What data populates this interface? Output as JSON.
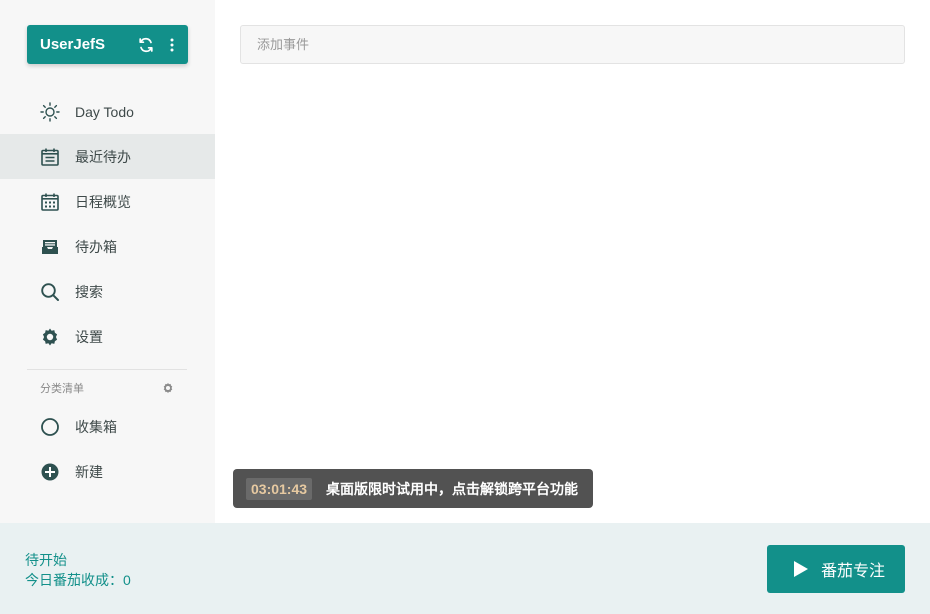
{
  "user": {
    "name": "UserJefS",
    "sync_icon": "refresh-icon",
    "menu_icon": "more-vertical-icon"
  },
  "nav": {
    "items": [
      {
        "label": "Day Todo",
        "icon": "sun-icon"
      },
      {
        "label": "最近待办",
        "icon": "calendar-list-icon",
        "active": true
      },
      {
        "label": "日程概览",
        "icon": "calendar-grid-icon"
      },
      {
        "label": "待办箱",
        "icon": "inbox-tray-icon"
      },
      {
        "label": "搜索",
        "icon": "search-icon"
      },
      {
        "label": "设置",
        "icon": "gear-icon"
      }
    ]
  },
  "categories": {
    "header": "分类清单",
    "gear_icon": "gear-icon",
    "items": [
      {
        "label": "收集箱",
        "icon": "circle-icon"
      },
      {
        "label": "新建",
        "icon": "plus-circle-icon"
      }
    ]
  },
  "main": {
    "add_event_placeholder": "添加事件"
  },
  "trial": {
    "timer": "03:01:43",
    "message": "桌面版限时试用中，点击解锁跨平台功能"
  },
  "footer": {
    "status": "待开始",
    "harvest": "今日番茄收成：0",
    "focus_button": "番茄专注"
  },
  "colors": {
    "accent": "#12908a",
    "sidebar_bg": "#f7f7f7",
    "footer_bg": "#e9f1f2",
    "icon": "#2e5150"
  }
}
